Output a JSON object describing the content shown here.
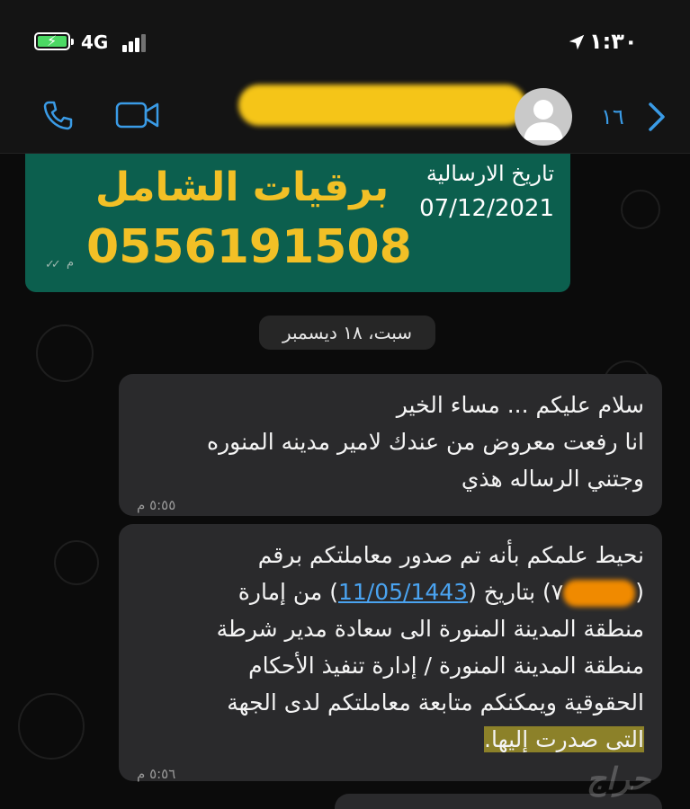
{
  "status_bar": {
    "network": "4G",
    "time": "١:٣٠"
  },
  "header": {
    "back_count": "١٦"
  },
  "pinned_ad": {
    "label": "تاريخ الارسالية",
    "date": "07/12/2021",
    "brand": "برقيات الشامل",
    "phone": "0556191508",
    "time_suffix": "م"
  },
  "date_separator": "سبت، ١٨ ديسمبر",
  "messages": [
    {
      "lines": [
        "سلام عليكم ... مساء الخير",
        "انا رفعت معروض من عندك لامير مدينه المنوره",
        "وجتني الرساله هذي"
      ],
      "time": "٥:٥٥ م"
    },
    {
      "line1": "نحيط علمكم بأنه تم صدور معاملتكم برقم",
      "line2_open": "(",
      "line2_mid": "٧",
      "line2_close": ") بتاريخ (",
      "line2_date": "11/05/1443",
      "line2_end": ") من إمارة",
      "line3": "منطقة المدينة المنورة الى سعادة مدير شرطة",
      "line4": "منطقة المدينة المنورة / إدارة تنفيذ الأحكام",
      "line5": "الحقوقية ويمكنكم متابعة معاملتكم لدى الجهة",
      "line6": "التى صدرت إليها.",
      "time": "٥:٥٦ م"
    }
  ],
  "watermark": "حراج",
  "colors": {
    "accent_blue": "#3a9be6",
    "ad_bubble": "#0c5f4e",
    "ad_text": "#f2c026",
    "incoming_bubble": "#2a2a2c"
  },
  "icons": [
    "battery-icon",
    "signal-icon",
    "location-arrow-icon",
    "phone-icon",
    "video-camera-icon",
    "avatar-icon",
    "chevron-right-icon"
  ]
}
